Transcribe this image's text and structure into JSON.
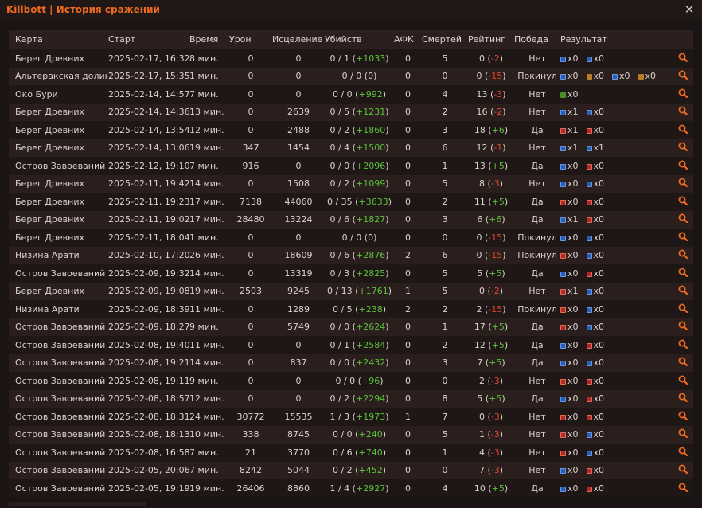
{
  "window": {
    "title": "Killbott | История сражений"
  },
  "table": {
    "headers": {
      "map": "Карта",
      "start": "Старт",
      "time": "Время",
      "damage": "Урон",
      "healing": "Исцеление",
      "kills": "Убийств",
      "afk": "АФК",
      "deaths": "Смертей",
      "rating": "Рейтинг",
      "win": "Победа",
      "result": "Результат"
    },
    "rows": [
      {
        "map": "Берег Древних",
        "start": "2025-02-17, 16:32",
        "time": "8 мин.",
        "damage": "0",
        "healing": "0",
        "kills_base": "0 / 1",
        "kills_delta": "+1033",
        "afk": "0",
        "deaths": "5",
        "rating_base": "0",
        "rating_delta": "-2",
        "win": "Нет",
        "results": [
          {
            "c": "blue",
            "t": "x0"
          },
          {
            "c": "blue",
            "t": "x0"
          }
        ]
      },
      {
        "map": "Альтеракская долина",
        "start": "2025-02-17, 15:35",
        "time": "1 мин.",
        "damage": "0",
        "healing": "0",
        "kills_base": "0 / 0",
        "kills_delta": "0",
        "afk": "0",
        "deaths": "0",
        "rating_base": "0",
        "rating_delta": "-15",
        "win": "Покинул",
        "results": [
          {
            "c": "blue",
            "t": "x0"
          },
          {
            "c": "gold",
            "t": "x0"
          },
          {
            "c": "blue",
            "t": "x0"
          },
          {
            "c": "gold",
            "t": "x0"
          }
        ]
      },
      {
        "map": "Око Бури",
        "start": "2025-02-14, 14:57",
        "time": "7 мин.",
        "damage": "0",
        "healing": "0",
        "kills_base": "0 / 0",
        "kills_delta": "+992",
        "afk": "0",
        "deaths": "4",
        "rating_base": "13",
        "rating_delta": "-3",
        "win": "Нет",
        "results": [
          {
            "c": "green",
            "t": "x0"
          }
        ]
      },
      {
        "map": "Берег Древних",
        "start": "2025-02-14, 14:36",
        "time": "13 мин.",
        "damage": "0",
        "healing": "2639",
        "kills_base": "0 / 5",
        "kills_delta": "+1231",
        "afk": "0",
        "deaths": "2",
        "rating_base": "16",
        "rating_delta": "-2",
        "win": "Нет",
        "results": [
          {
            "c": "blue",
            "t": "x1"
          },
          {
            "c": "blue",
            "t": "x0"
          }
        ]
      },
      {
        "map": "Берег Древних",
        "start": "2025-02-14, 13:54",
        "time": "12 мин.",
        "damage": "0",
        "healing": "2488",
        "kills_base": "0 / 2",
        "kills_delta": "+1860",
        "afk": "0",
        "deaths": "3",
        "rating_base": "18",
        "rating_delta": "+6",
        "win": "Да",
        "results": [
          {
            "c": "red",
            "t": "x1"
          },
          {
            "c": "red",
            "t": "x0"
          }
        ]
      },
      {
        "map": "Берег Древних",
        "start": "2025-02-14, 13:06",
        "time": "19 мин.",
        "damage": "347",
        "healing": "1454",
        "kills_base": "0 / 4",
        "kills_delta": "+1500",
        "afk": "0",
        "deaths": "6",
        "rating_base": "12",
        "rating_delta": "-1",
        "win": "Нет",
        "results": [
          {
            "c": "blue",
            "t": "x1"
          },
          {
            "c": "blue",
            "t": "x1"
          }
        ]
      },
      {
        "map": "Остров Завоеваний",
        "start": "2025-02-12, 19:10",
        "time": "7 мин.",
        "damage": "916",
        "healing": "0",
        "kills_base": "0 / 0",
        "kills_delta": "+2096",
        "afk": "0",
        "deaths": "1",
        "rating_base": "13",
        "rating_delta": "+5",
        "win": "Да",
        "results": [
          {
            "c": "blue",
            "t": "x0"
          },
          {
            "c": "red",
            "t": "x0"
          }
        ]
      },
      {
        "map": "Берег Древних",
        "start": "2025-02-11, 19:42",
        "time": "14 мин.",
        "damage": "0",
        "healing": "1508",
        "kills_base": "0 / 2",
        "kills_delta": "+1099",
        "afk": "0",
        "deaths": "5",
        "rating_base": "8",
        "rating_delta": "-3",
        "win": "Нет",
        "results": [
          {
            "c": "blue",
            "t": "x0"
          },
          {
            "c": "blue",
            "t": "x0"
          }
        ]
      },
      {
        "map": "Берег Древних",
        "start": "2025-02-11, 19:23",
        "time": "17 мин.",
        "damage": "7138",
        "healing": "44060",
        "kills_base": "0 / 35",
        "kills_delta": "+3633",
        "afk": "0",
        "deaths": "2",
        "rating_base": "11",
        "rating_delta": "+5",
        "win": "Да",
        "results": [
          {
            "c": "red",
            "t": "x0"
          },
          {
            "c": "red",
            "t": "x0"
          }
        ]
      },
      {
        "map": "Берег Древних",
        "start": "2025-02-11, 19:02",
        "time": "17 мин.",
        "damage": "28480",
        "healing": "13224",
        "kills_base": "0 / 6",
        "kills_delta": "+1827",
        "afk": "0",
        "deaths": "3",
        "rating_base": "6",
        "rating_delta": "+6",
        "win": "Да",
        "results": [
          {
            "c": "blue",
            "t": "x1"
          },
          {
            "c": "red",
            "t": "x0"
          }
        ]
      },
      {
        "map": "Берег Древних",
        "start": "2025-02-11, 18:04",
        "time": "1 мин.",
        "damage": "0",
        "healing": "0",
        "kills_base": "0 / 0",
        "kills_delta": "0",
        "afk": "0",
        "deaths": "0",
        "rating_base": "0",
        "rating_delta": "-15",
        "win": "Покинул",
        "results": [
          {
            "c": "blue",
            "t": "x0"
          },
          {
            "c": "blue",
            "t": "x0"
          }
        ]
      },
      {
        "map": "Низина Арати",
        "start": "2025-02-10, 17:20",
        "time": "26 мин.",
        "damage": "0",
        "healing": "18609",
        "kills_base": "0 / 6",
        "kills_delta": "+2876",
        "afk": "2",
        "deaths": "6",
        "rating_base": "0",
        "rating_delta": "-15",
        "win": "Покинул",
        "results": [
          {
            "c": "red",
            "t": "x0"
          },
          {
            "c": "blue",
            "t": "x0"
          }
        ]
      },
      {
        "map": "Остров Завоеваний",
        "start": "2025-02-09, 19:32",
        "time": "14 мин.",
        "damage": "0",
        "healing": "13319",
        "kills_base": "0 / 3",
        "kills_delta": "+2825",
        "afk": "0",
        "deaths": "5",
        "rating_base": "5",
        "rating_delta": "+5",
        "win": "Да",
        "results": [
          {
            "c": "blue",
            "t": "x0"
          },
          {
            "c": "red",
            "t": "x0"
          }
        ]
      },
      {
        "map": "Берег Древних",
        "start": "2025-02-09, 19:08",
        "time": "19 мин.",
        "damage": "2503",
        "healing": "9245",
        "kills_base": "0 / 13",
        "kills_delta": "+1761",
        "afk": "1",
        "deaths": "5",
        "rating_base": "0",
        "rating_delta": "-2",
        "win": "Нет",
        "results": [
          {
            "c": "red",
            "t": "x1"
          },
          {
            "c": "blue",
            "t": "x0"
          }
        ]
      },
      {
        "map": "Низина Арати",
        "start": "2025-02-09, 18:39",
        "time": "11 мин.",
        "damage": "0",
        "healing": "1289",
        "kills_base": "0 / 5",
        "kills_delta": "+238",
        "afk": "2",
        "deaths": "2",
        "rating_base": "2",
        "rating_delta": "-15",
        "win": "Покинул",
        "results": [
          {
            "c": "red",
            "t": "x0"
          },
          {
            "c": "blue",
            "t": "x0"
          }
        ]
      },
      {
        "map": "Остров Завоеваний",
        "start": "2025-02-09, 18:27",
        "time": "9 мин.",
        "damage": "0",
        "healing": "5749",
        "kills_base": "0 / 0",
        "kills_delta": "+2624",
        "afk": "0",
        "deaths": "1",
        "rating_base": "17",
        "rating_delta": "+5",
        "win": "Да",
        "results": [
          {
            "c": "red",
            "t": "x0"
          },
          {
            "c": "blue",
            "t": "x0"
          }
        ]
      },
      {
        "map": "Остров Завоеваний",
        "start": "2025-02-08, 19:40",
        "time": "11 мин.",
        "damage": "0",
        "healing": "0",
        "kills_base": "0 / 1",
        "kills_delta": "+2584",
        "afk": "0",
        "deaths": "2",
        "rating_base": "12",
        "rating_delta": "+5",
        "win": "Да",
        "results": [
          {
            "c": "blue",
            "t": "x0"
          },
          {
            "c": "red",
            "t": "x0"
          }
        ]
      },
      {
        "map": "Остров Завоеваний",
        "start": "2025-02-08, 19:21",
        "time": "14 мин.",
        "damage": "0",
        "healing": "837",
        "kills_base": "0 / 0",
        "kills_delta": "+2432",
        "afk": "0",
        "deaths": "3",
        "rating_base": "7",
        "rating_delta": "+5",
        "win": "Да",
        "results": [
          {
            "c": "blue",
            "t": "x0"
          },
          {
            "c": "blue",
            "t": "x0"
          }
        ]
      },
      {
        "map": "Остров Завоеваний",
        "start": "2025-02-08, 19:11",
        "time": "9 мин.",
        "damage": "0",
        "healing": "0",
        "kills_base": "0 / 0",
        "kills_delta": "+96",
        "afk": "0",
        "deaths": "0",
        "rating_base": "2",
        "rating_delta": "-3",
        "win": "Нет",
        "results": [
          {
            "c": "red",
            "t": "x0"
          },
          {
            "c": "red",
            "t": "x0"
          }
        ]
      },
      {
        "map": "Остров Завоеваний",
        "start": "2025-02-08, 18:57",
        "time": "12 мин.",
        "damage": "0",
        "healing": "0",
        "kills_base": "0 / 2",
        "kills_delta": "+2294",
        "afk": "0",
        "deaths": "8",
        "rating_base": "5",
        "rating_delta": "+5",
        "win": "Да",
        "results": [
          {
            "c": "blue",
            "t": "x0"
          },
          {
            "c": "red",
            "t": "x0"
          }
        ]
      },
      {
        "map": "Остров Завоеваний",
        "start": "2025-02-08, 18:31",
        "time": "24 мин.",
        "damage": "30772",
        "healing": "15535",
        "kills_base": "1 / 3",
        "kills_delta": "+1973",
        "afk": "1",
        "deaths": "7",
        "rating_base": "0",
        "rating_delta": "-3",
        "win": "Нет",
        "results": [
          {
            "c": "red",
            "t": "x0"
          },
          {
            "c": "red",
            "t": "x0"
          }
        ]
      },
      {
        "map": "Остров Завоеваний",
        "start": "2025-02-08, 18:13",
        "time": "10 мин.",
        "damage": "338",
        "healing": "8745",
        "kills_base": "0 / 0",
        "kills_delta": "+240",
        "afk": "0",
        "deaths": "5",
        "rating_base": "1",
        "rating_delta": "-3",
        "win": "Нет",
        "results": [
          {
            "c": "red",
            "t": "x0"
          },
          {
            "c": "blue",
            "t": "x0"
          }
        ]
      },
      {
        "map": "Остров Завоеваний",
        "start": "2025-02-08, 16:58",
        "time": "7 мин.",
        "damage": "21",
        "healing": "3770",
        "kills_base": "0 / 6",
        "kills_delta": "+740",
        "afk": "0",
        "deaths": "1",
        "rating_base": "4",
        "rating_delta": "-3",
        "win": "Нет",
        "results": [
          {
            "c": "red",
            "t": "x0"
          },
          {
            "c": "blue",
            "t": "x0"
          }
        ]
      },
      {
        "map": "Остров Завоеваний",
        "start": "2025-02-05, 20:06",
        "time": "7 мин.",
        "damage": "8242",
        "healing": "5044",
        "kills_base": "0 / 2",
        "kills_delta": "+452",
        "afk": "0",
        "deaths": "0",
        "rating_base": "7",
        "rating_delta": "-3",
        "win": "Нет",
        "results": [
          {
            "c": "blue",
            "t": "x0"
          },
          {
            "c": "red",
            "t": "x0"
          }
        ]
      },
      {
        "map": "Остров Завоеваний",
        "start": "2025-02-05, 19:19",
        "time": "19 мин.",
        "damage": "26406",
        "healing": "8860",
        "kills_base": "1 / 4",
        "kills_delta": "+2927",
        "afk": "0",
        "deaths": "4",
        "rating_base": "10",
        "rating_delta": "+5",
        "win": "Да",
        "results": [
          {
            "c": "blue",
            "t": "x0"
          },
          {
            "c": "red",
            "t": "x0"
          }
        ]
      }
    ]
  },
  "icons": {
    "close": "close-icon",
    "row_action": "magnifier-icon"
  },
  "colors": {
    "accent": "#ef6a1e",
    "positive": "#5cc23b",
    "negative": "#e2462f"
  }
}
